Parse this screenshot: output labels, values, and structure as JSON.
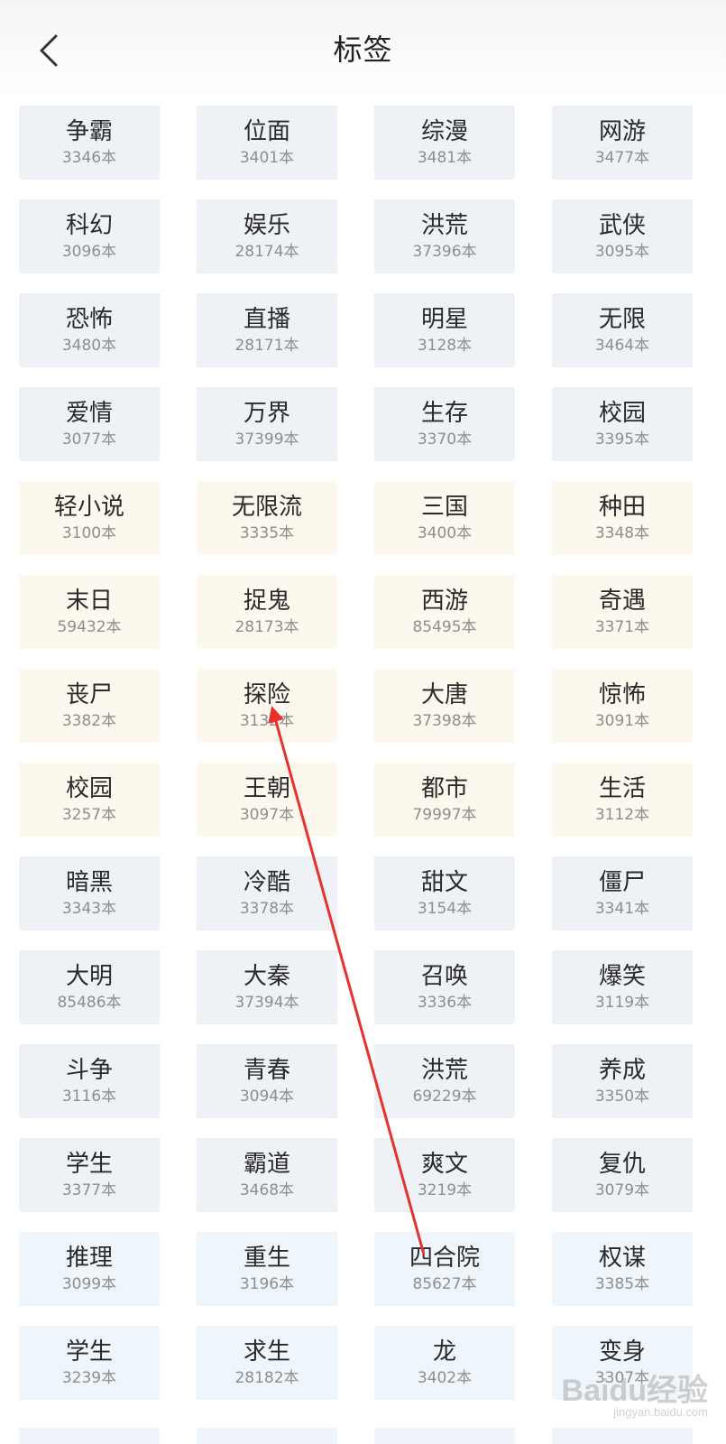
{
  "header": {
    "title": "标签"
  },
  "colors": {
    "gray_tag": "#eef1f6",
    "cream_tag": "#fdf8ee",
    "blue_tag": "#eef5fb",
    "arrow": "#e8302c"
  },
  "tags": [
    {
      "name": "争霸",
      "count": "3346本",
      "tone": "gray"
    },
    {
      "name": "位面",
      "count": "3401本",
      "tone": "gray"
    },
    {
      "name": "综漫",
      "count": "3481本",
      "tone": "gray"
    },
    {
      "name": "网游",
      "count": "3477本",
      "tone": "gray"
    },
    {
      "name": "科幻",
      "count": "3096本",
      "tone": "gray"
    },
    {
      "name": "娱乐",
      "count": "28174本",
      "tone": "gray"
    },
    {
      "name": "洪荒",
      "count": "37396本",
      "tone": "gray"
    },
    {
      "name": "武侠",
      "count": "3095本",
      "tone": "gray"
    },
    {
      "name": "恐怖",
      "count": "3480本",
      "tone": "gray"
    },
    {
      "name": "直播",
      "count": "28171本",
      "tone": "gray"
    },
    {
      "name": "明星",
      "count": "3128本",
      "tone": "gray"
    },
    {
      "name": "无限",
      "count": "3464本",
      "tone": "gray"
    },
    {
      "name": "爱情",
      "count": "3077本",
      "tone": "gray"
    },
    {
      "name": "万界",
      "count": "37399本",
      "tone": "gray"
    },
    {
      "name": "生存",
      "count": "3370本",
      "tone": "gray"
    },
    {
      "name": "校园",
      "count": "3395本",
      "tone": "gray"
    },
    {
      "name": "轻小说",
      "count": "3100本",
      "tone": "cream"
    },
    {
      "name": "无限流",
      "count": "3335本",
      "tone": "cream"
    },
    {
      "name": "三国",
      "count": "3400本",
      "tone": "cream"
    },
    {
      "name": "种田",
      "count": "3348本",
      "tone": "cream"
    },
    {
      "name": "末日",
      "count": "59432本",
      "tone": "cream"
    },
    {
      "name": "捉鬼",
      "count": "28173本",
      "tone": "cream"
    },
    {
      "name": "西游",
      "count": "85495本",
      "tone": "cream"
    },
    {
      "name": "奇遇",
      "count": "3371本",
      "tone": "cream"
    },
    {
      "name": "丧尸",
      "count": "3382本",
      "tone": "cream"
    },
    {
      "name": "探险",
      "count": "3132本",
      "tone": "cream"
    },
    {
      "name": "大唐",
      "count": "37398本",
      "tone": "cream"
    },
    {
      "name": "惊怖",
      "count": "3091本",
      "tone": "cream"
    },
    {
      "name": "校园",
      "count": "3257本",
      "tone": "cream"
    },
    {
      "name": "王朝",
      "count": "3097本",
      "tone": "cream"
    },
    {
      "name": "都市",
      "count": "79997本",
      "tone": "cream"
    },
    {
      "name": "生活",
      "count": "3112本",
      "tone": "cream"
    },
    {
      "name": "暗黑",
      "count": "3343本",
      "tone": "gray"
    },
    {
      "name": "冷酷",
      "count": "3378本",
      "tone": "gray"
    },
    {
      "name": "甜文",
      "count": "3154本",
      "tone": "gray"
    },
    {
      "name": "僵尸",
      "count": "3341本",
      "tone": "gray"
    },
    {
      "name": "大明",
      "count": "85486本",
      "tone": "gray"
    },
    {
      "name": "大秦",
      "count": "37394本",
      "tone": "gray"
    },
    {
      "name": "召唤",
      "count": "3336本",
      "tone": "gray"
    },
    {
      "name": "爆笑",
      "count": "3119本",
      "tone": "gray"
    },
    {
      "name": "斗争",
      "count": "3116本",
      "tone": "gray"
    },
    {
      "name": "青春",
      "count": "3094本",
      "tone": "gray"
    },
    {
      "name": "洪荒",
      "count": "69229本",
      "tone": "gray"
    },
    {
      "name": "养成",
      "count": "3350本",
      "tone": "gray"
    },
    {
      "name": "学生",
      "count": "3377本",
      "tone": "gray"
    },
    {
      "name": "霸道",
      "count": "3468本",
      "tone": "gray"
    },
    {
      "name": "爽文",
      "count": "3219本",
      "tone": "gray"
    },
    {
      "name": "复仇",
      "count": "3079本",
      "tone": "gray"
    },
    {
      "name": "推理",
      "count": "3099本",
      "tone": "blue"
    },
    {
      "name": "重生",
      "count": "3196本",
      "tone": "blue"
    },
    {
      "name": "四合院",
      "count": "85627本",
      "tone": "blue"
    },
    {
      "name": "权谋",
      "count": "3385本",
      "tone": "blue"
    },
    {
      "name": "学生",
      "count": "3239本",
      "tone": "blue"
    },
    {
      "name": "求生",
      "count": "28182本",
      "tone": "blue"
    },
    {
      "name": "龙",
      "count": "3402本",
      "tone": "blue"
    },
    {
      "name": "变身",
      "count": "3307本",
      "tone": "blue"
    }
  ],
  "watermark": {
    "main": "Baidu经验",
    "sub": "jingyan.baidu.com"
  }
}
